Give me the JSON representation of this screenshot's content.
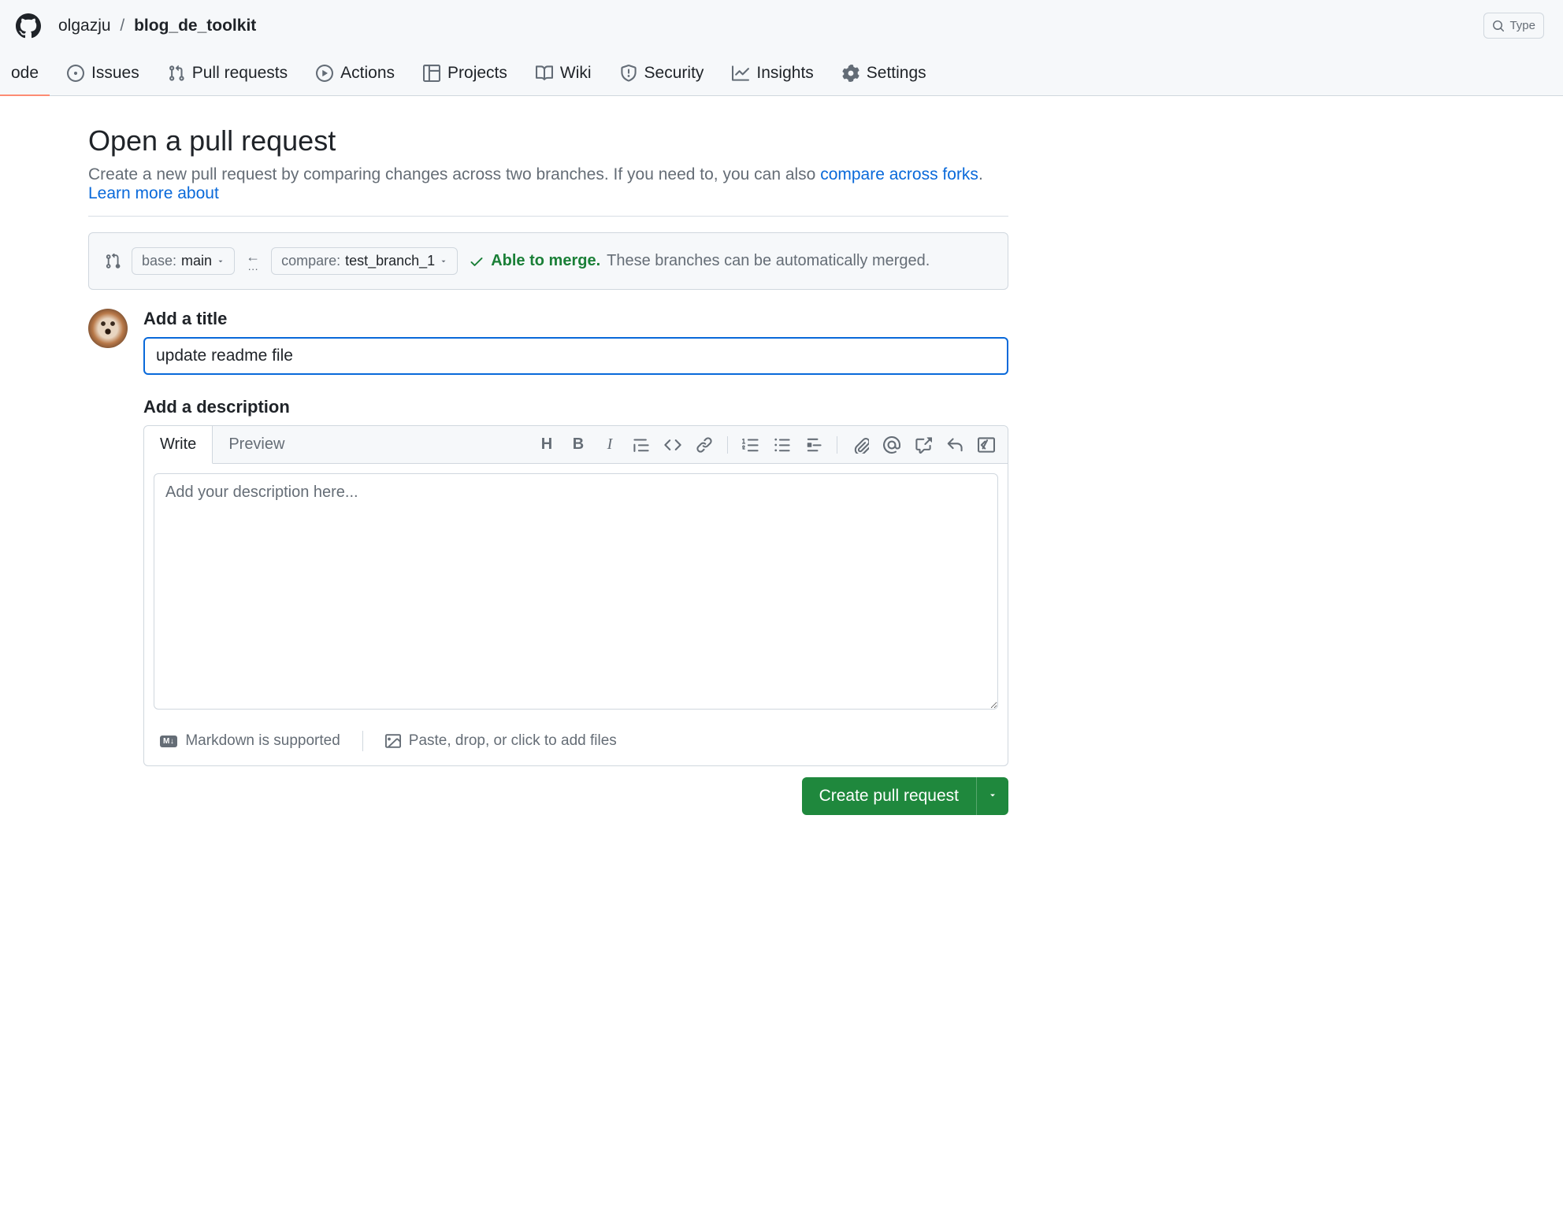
{
  "header": {
    "owner": "olgazju",
    "repo": "blog_de_toolkit",
    "search_placeholder": "Type"
  },
  "nav": {
    "items": [
      {
        "label": "ode"
      },
      {
        "label": "Issues"
      },
      {
        "label": "Pull requests"
      },
      {
        "label": "Actions"
      },
      {
        "label": "Projects"
      },
      {
        "label": "Wiki"
      },
      {
        "label": "Security"
      },
      {
        "label": "Insights"
      },
      {
        "label": "Settings"
      }
    ]
  },
  "page": {
    "title": "Open a pull request",
    "subtitle_pre": "Create a new pull request by comparing changes across two branches. If you need to, you can also ",
    "subtitle_link1": "compare across forks",
    "subtitle_mid": ". ",
    "subtitle_link2": "Learn more about"
  },
  "compare": {
    "base_label": "base: ",
    "base_value": "main",
    "compare_label": "compare: ",
    "compare_value": "test_branch_1",
    "merge_able": "Able to merge.",
    "merge_desc": "These branches can be automatically merged."
  },
  "form": {
    "title_label": "Add a title",
    "title_value": "update readme file",
    "desc_label": "Add a description",
    "desc_placeholder": "Add your description here...",
    "tab_write": "Write",
    "tab_preview": "Preview",
    "markdown_hint": "Markdown is supported",
    "attach_hint": "Paste, drop, or click to add files",
    "submit": "Create pull request"
  }
}
